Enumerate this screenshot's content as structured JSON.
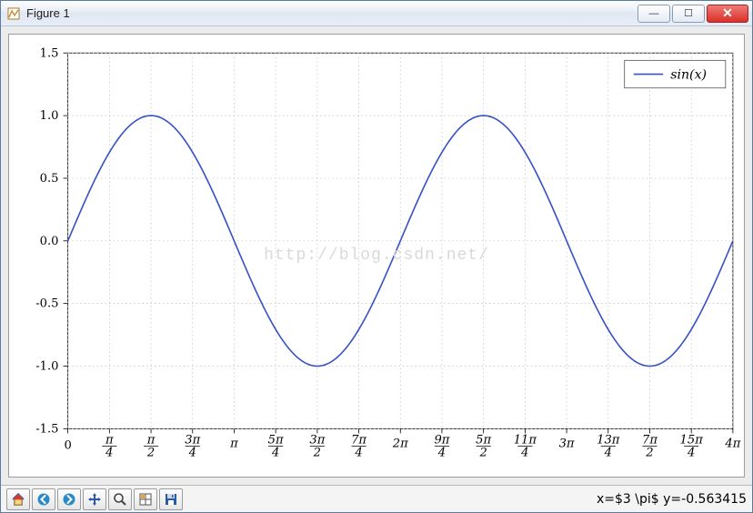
{
  "window": {
    "title": "Figure 1",
    "controls": {
      "min": "—",
      "max": "☐",
      "close": "✕"
    }
  },
  "toolbar": {
    "home": "home-icon",
    "back": "arrow-left-icon",
    "forward": "arrow-right-icon",
    "pan": "move-icon",
    "zoom": "zoom-icon",
    "subplot": "subplot-icon",
    "save": "save-icon"
  },
  "status": {
    "text": "x=$3 \\pi$ y=-0.563415"
  },
  "watermark": "http://blog.csdn.net/",
  "legend": {
    "label": "sin(x)"
  },
  "chart_data": {
    "type": "line",
    "series": [
      {
        "name": "sin(x)",
        "color": "#3852c4"
      }
    ],
    "x_range_radians": [
      0,
      12.566370614
    ],
    "xlabel": "",
    "ylabel": "",
    "ylim": [
      -1.5,
      1.5
    ],
    "yticks": [
      -1.5,
      -1.0,
      -0.5,
      0.0,
      0.5,
      1.0,
      1.5
    ],
    "ytick_labels": [
      "-1.5",
      "-1.0",
      "-0.5",
      "0.0",
      "0.5",
      "1.0",
      "1.5"
    ],
    "xticks_radians": [
      0,
      0.785398,
      1.570796,
      2.356194,
      3.141593,
      3.926991,
      4.712389,
      5.497787,
      6.283185,
      7.068583,
      7.853982,
      8.63938,
      9.424778,
      10.210176,
      10.995574,
      11.780972,
      12.56637
    ],
    "xtick_labels_tex": [
      "0",
      "\\frac{\\pi}{4}",
      "\\frac{\\pi}{2}",
      "\\frac{3\\pi}{4}",
      "\\pi",
      "\\frac{5\\pi}{4}",
      "\\frac{3\\pi}{2}",
      "\\frac{7\\pi}{4}",
      "2\\pi",
      "\\frac{9\\pi}{4}",
      "\\frac{5\\pi}{2}",
      "\\frac{11\\pi}{4}",
      "3\\pi",
      "\\frac{13\\pi}{4}",
      "\\frac{7\\pi}{2}",
      "\\frac{15\\pi}{4}",
      "4\\pi"
    ],
    "xtick_labels_display": [
      "0",
      "π/4",
      "π/2",
      "3π/4",
      "π",
      "5π/4",
      "3π/2",
      "7π/4",
      "2π",
      "9π/4",
      "5π/2",
      "11π/4",
      "3π",
      "13π/4",
      "7π/2",
      "15π/4",
      "4π"
    ]
  }
}
